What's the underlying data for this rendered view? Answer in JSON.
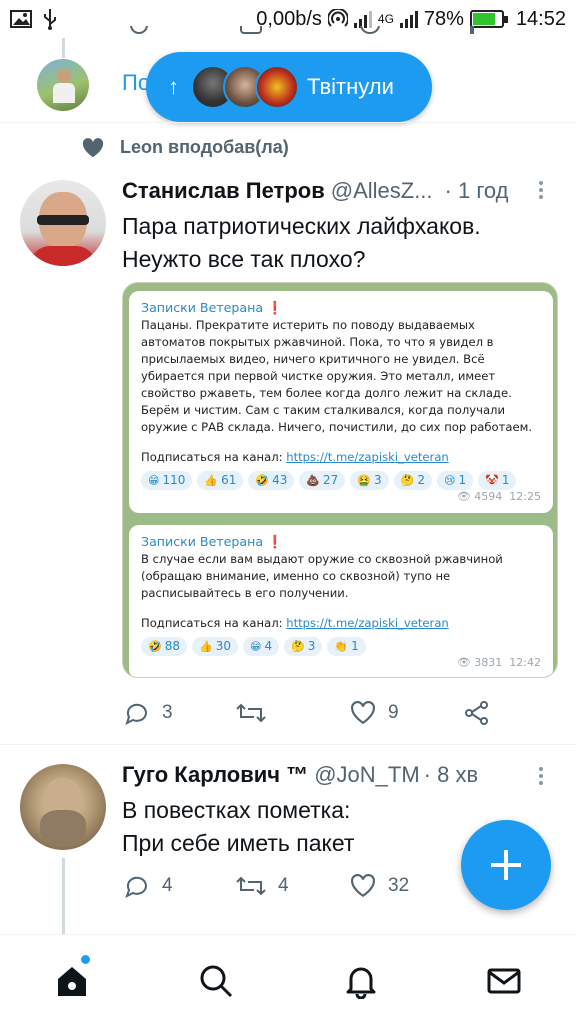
{
  "status_bar": {
    "network_speed": "0,00b/s",
    "network_type": "4G",
    "battery": "78%",
    "battery_level": 0.78,
    "time": "14:52"
  },
  "top_tweet": {
    "show_thread_label": "По"
  },
  "new_tweets_pill": {
    "label": "Твітнули"
  },
  "tweet1": {
    "liked_by": "Leon вподобав(ла)",
    "author_name": "Станислав Петров",
    "handle": "@AllesZ...",
    "time": "· 1 год",
    "text_line1": "Пара патриотических лайфхаков.",
    "text_line2": "Неужто все так плохо?",
    "media": {
      "post1": {
        "channel": "Записки Ветерана",
        "body": "Пацаны. Прекратите истерить по поводу выдаваемых автоматов покрытых ржавчиной. Пока, то что я увидел в присылаемых видео, ничего критичного не увидел. Всё убирается при первой чистке оружия. Это металл, имеет свойство ржаветь, тем более когда долго лежит на складе. Берём и чистим. Сам с таким сталкивался, когда получали оружие с РАВ склада. Ничего, почистили, до сих пор работаем.",
        "subscribe": "Подписаться на канал:",
        "link": "https://t.me/zapiski_veteran",
        "reactions": [
          {
            "emoji": "😁",
            "count": "110"
          },
          {
            "emoji": "👍",
            "count": "61"
          },
          {
            "emoji": "🤣",
            "count": "43"
          },
          {
            "emoji": "💩",
            "count": "27"
          },
          {
            "emoji": "🤮",
            "count": "3"
          },
          {
            "emoji": "🤔",
            "count": "2"
          },
          {
            "emoji": "😢",
            "count": "1"
          },
          {
            "emoji": "🤡",
            "count": "1"
          }
        ],
        "views": "4594",
        "time": "12:25"
      },
      "post2": {
        "channel": "Записки Ветерана",
        "body": "В случае если вам выдают оружие со сквозной ржавчиной (обращаю внимание, именно со сквозной) тупо не расписывайтесь в его получении.",
        "subscribe": "Подписаться на канал:",
        "link": "https://t.me/zapiski_veteran",
        "reactions": [
          {
            "emoji": "🤣",
            "count": "88"
          },
          {
            "emoji": "👍",
            "count": "30"
          },
          {
            "emoji": "😁",
            "count": "4"
          },
          {
            "emoji": "🤔",
            "count": "3"
          },
          {
            "emoji": "👏",
            "count": "1"
          }
        ],
        "views": "3831",
        "time": "12:42"
      }
    },
    "replies": "3",
    "retweets": "",
    "likes": "9"
  },
  "tweet2": {
    "author_name": "Гуго Карлович ™",
    "handle": "@JoN_TM",
    "time": "· 8 хв",
    "text_line1": "В повестках пометка:",
    "text_line2": "При себе иметь пакет",
    "replies": "4",
    "retweets": "4",
    "likes": "32"
  },
  "colors": {
    "accent": "#1d9bf0",
    "secondary_text": "#536471",
    "media_background": "#9dbb86"
  },
  "icons": [
    "home-icon",
    "search-icon",
    "notifications-icon",
    "messages-icon",
    "compose-icon",
    "heart-icon",
    "reply-icon",
    "retweet-icon",
    "like-icon",
    "share-icon"
  ]
}
